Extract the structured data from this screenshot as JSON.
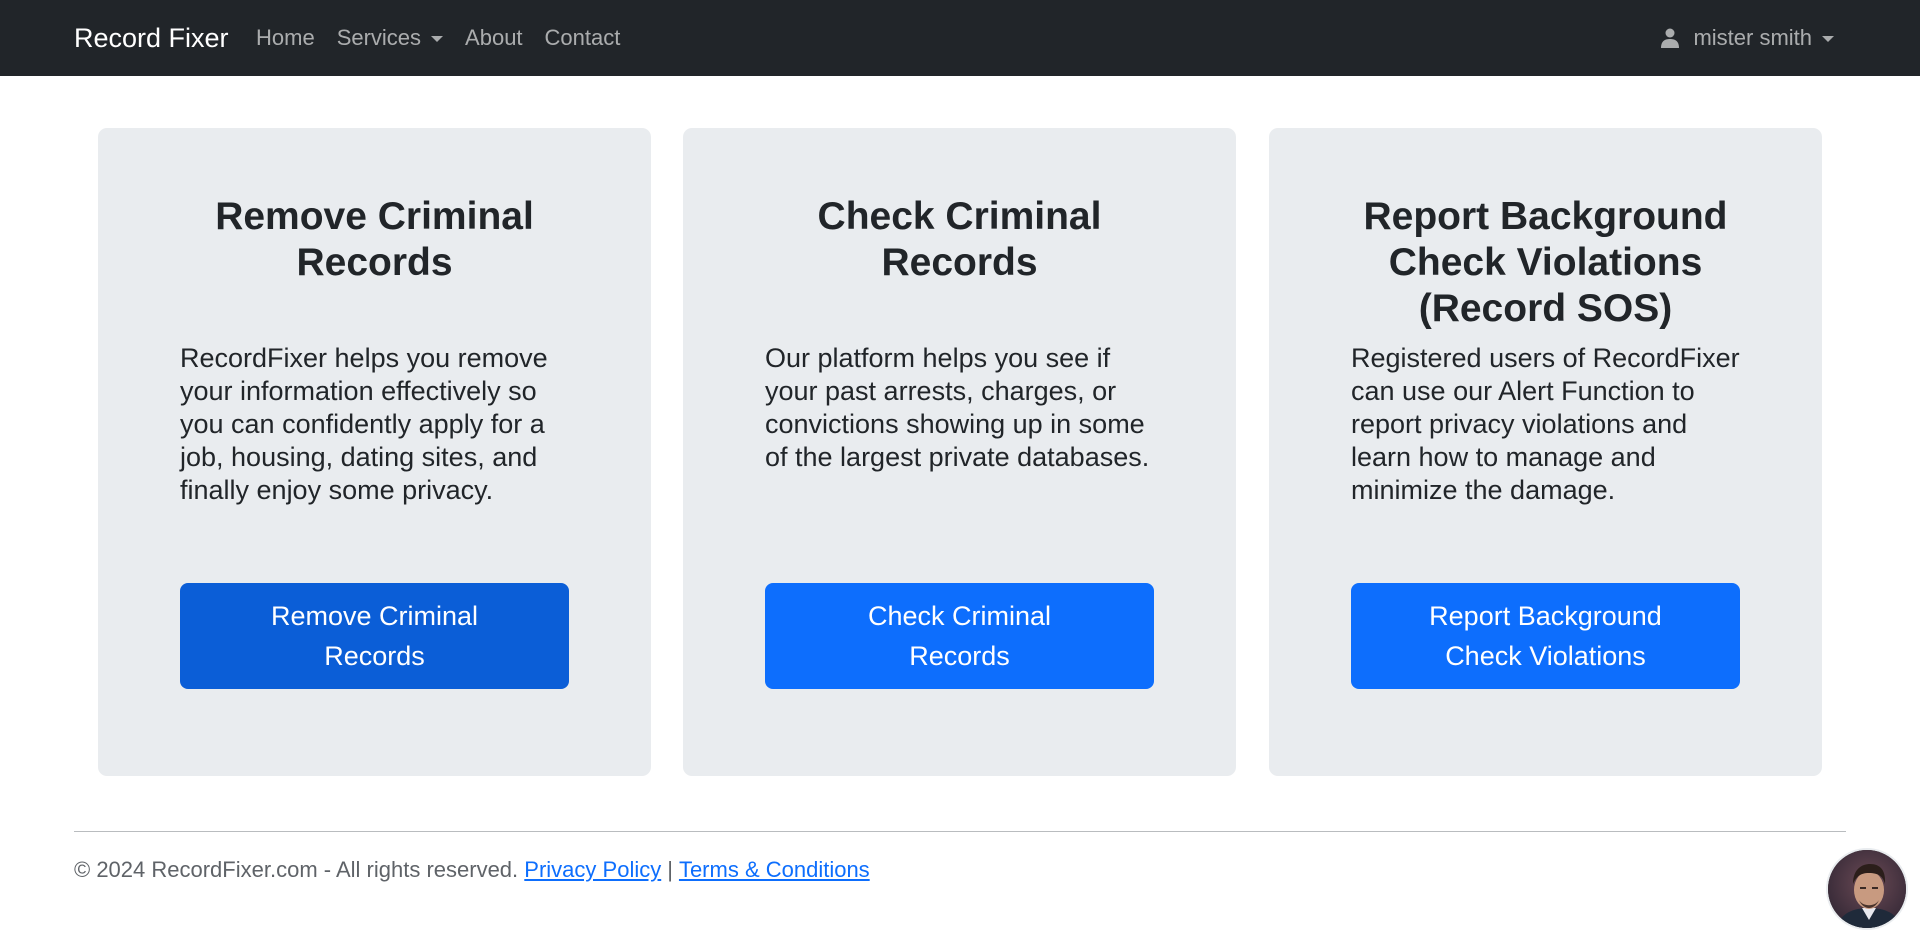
{
  "nav": {
    "brand": "Record Fixer",
    "links": [
      "Home",
      "Services",
      "About",
      "Contact"
    ],
    "user_name": "mister smith"
  },
  "cards": [
    {
      "title": "Remove Criminal Records",
      "text": "RecordFixer helps you remove your information effectively so you can confidently apply for a job, housing, dating sites, and finally enjoy some privacy.",
      "button": "Remove Criminal Records"
    },
    {
      "title": "Check Criminal Records",
      "text": "Our platform helps you see if your past arrests, charges, or convictions showing up in some of the largest private databases.",
      "button": "Check Criminal Records"
    },
    {
      "title": "Report Background Check Violations (Record SOS)",
      "text": "Registered users of RecordFixer can use our Alert Function to report privacy violations and learn how to manage and minimize the damage.",
      "button": "Report Background Check Violations"
    }
  ],
  "footer": {
    "copyright": "© 2024 RecordFixer.com - All rights reserved.",
    "privacy": "Privacy Policy",
    "separator": "|",
    "terms": "Terms & Conditions"
  },
  "colors": {
    "navbar": "#212529",
    "card_bg": "#e9ecef",
    "primary": "#0d6efd",
    "primary_active": "#0b5ed7",
    "link": "#0d6efd"
  },
  "icons": {
    "user": "person-icon",
    "dropdown": "caret-down-icon"
  }
}
